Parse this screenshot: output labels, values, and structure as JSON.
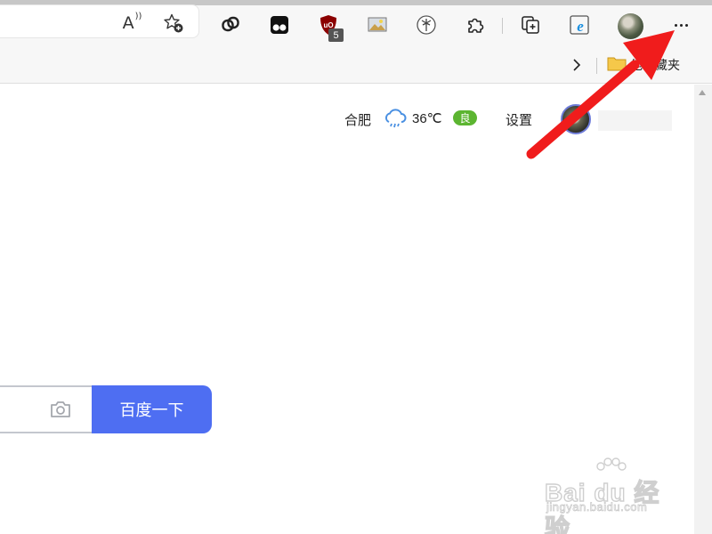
{
  "browser": {
    "favorites_bar": {
      "folder_label": "他收藏夹"
    },
    "extensions": [
      {
        "icon": "chain-link-icon"
      },
      {
        "icon": "tampermonkey-icon"
      },
      {
        "icon": "ublock-shield-icon",
        "badge": "5"
      },
      {
        "icon": "image-icon"
      },
      {
        "icon": "palm-tree-icon"
      },
      {
        "icon": "puzzle-extensions-icon"
      },
      {
        "icon": "collections-icon"
      },
      {
        "icon": "edge-ie-mode-icon"
      }
    ],
    "read_aloud_label": "A"
  },
  "page": {
    "header": {
      "city": "合肥",
      "temperature": "36℃",
      "air_quality": "良",
      "settings_label": "设置"
    },
    "search": {
      "button_label": "百度一下"
    },
    "watermark": {
      "logo_text": "Bai du 经验",
      "url_text": "jingyan.baidu.com"
    }
  },
  "colors": {
    "search_button": "#4e6ef2",
    "aqi_badge": "#5cb531",
    "annotation_arrow": "#f01c1c"
  }
}
